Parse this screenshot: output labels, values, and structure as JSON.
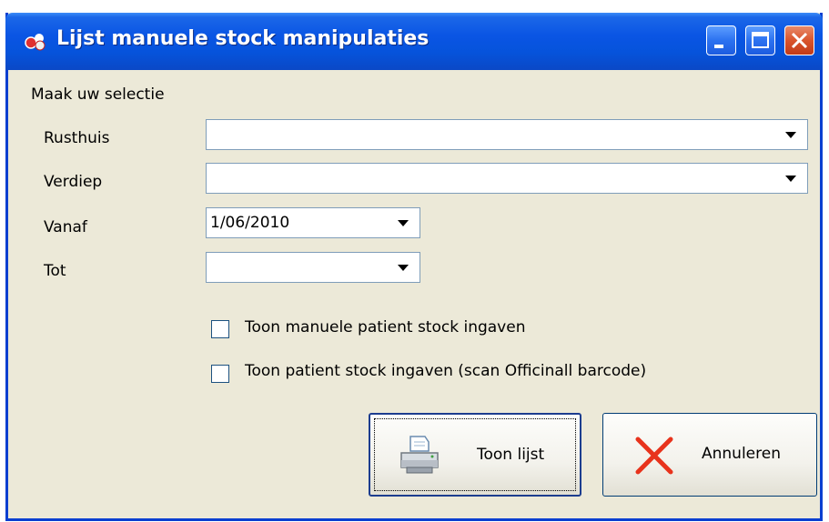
{
  "window": {
    "title": "Lijst manuele stock manipulaties"
  },
  "form": {
    "section_label": "Maak uw selectie",
    "rusthuis": {
      "label": "Rusthuis",
      "value": ""
    },
    "verdiep": {
      "label": "Verdiep",
      "value": ""
    },
    "vanaf": {
      "label": "Vanaf",
      "value": "1/06/2010"
    },
    "tot": {
      "label": "Tot",
      "value": ""
    },
    "checkbox_manual": {
      "label": "Toon manuele patient stock ingaven",
      "checked": false
    },
    "checkbox_scan": {
      "label": "Toon patient stock ingaven (scan Officinall barcode)",
      "checked": false
    }
  },
  "buttons": {
    "show_list": {
      "label": "Toon lijst",
      "icon": "printer-icon"
    },
    "cancel": {
      "label": "Annuleren",
      "icon": "cross-icon"
    }
  },
  "colors": {
    "titlebar": "#0a55e4",
    "window_bg": "#ece9d8",
    "close_button": "#d9542c",
    "cancel_cross": "#e8331c"
  }
}
